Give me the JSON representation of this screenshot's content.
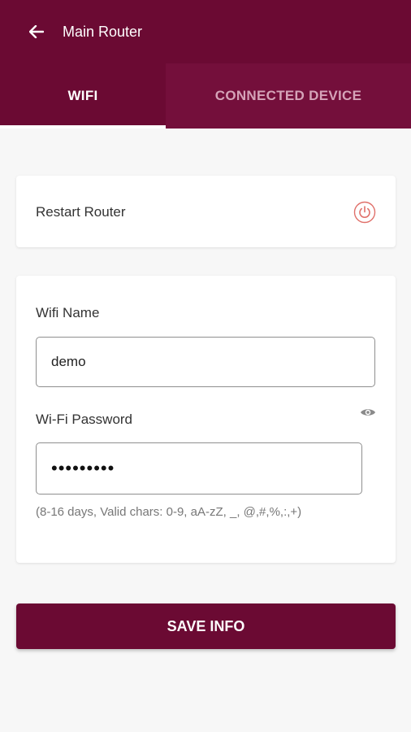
{
  "appbar": {
    "back_icon": "arrow-left-icon",
    "title": "Main Router"
  },
  "tabs": [
    {
      "label": "WIFI",
      "active": true
    },
    {
      "label": "CONNECTED DEVICE",
      "active": false
    }
  ],
  "restart": {
    "label": "Restart Router",
    "icon": "power-icon"
  },
  "form": {
    "wifi_name_label": "Wifi Name",
    "wifi_name_value": "demo",
    "wifi_password_label": "Wi-Fi Password",
    "wifi_password_value": "•••••••••",
    "password_toggle_icon": "eye-icon",
    "hint": "(8-16 days, Valid chars: 0-9, aA-zZ, _, @,#,%,:,+)"
  },
  "save_button": {
    "label": "SAVE INFO"
  },
  "colors": {
    "primary": "#6b0a33",
    "tab_inactive_bg": "#740f3b",
    "tab_inactive_text": "#d5a3b8",
    "restart_icon": "#e0706a",
    "background": "#f7f7f7"
  }
}
